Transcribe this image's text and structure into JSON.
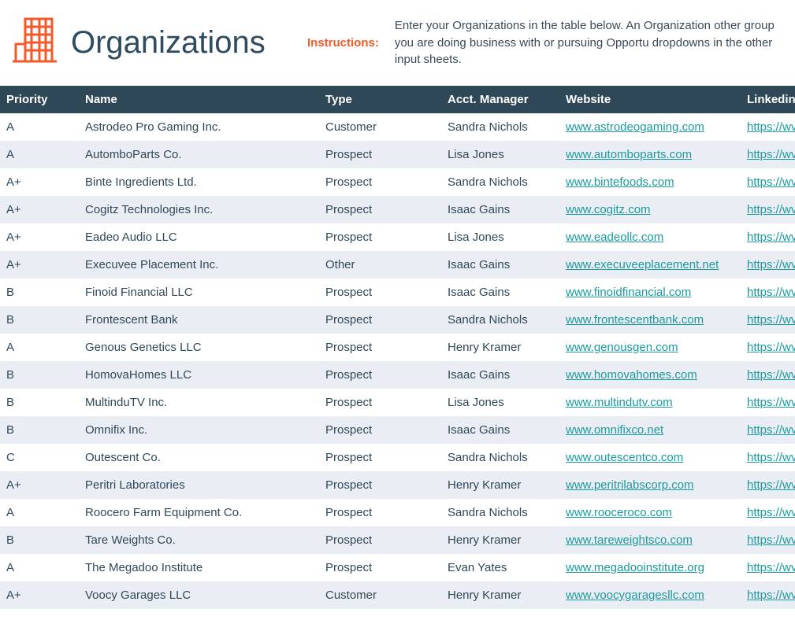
{
  "header": {
    "title": "Organizations",
    "instructions_label": "Instructions:",
    "instructions_text": "Enter your Organizations in the table below. An Organization other group you are doing business with or pursuing Opportu dropdowns in the other input sheets."
  },
  "columns": {
    "priority": "Priority",
    "name": "Name",
    "type": "Type",
    "manager": "Acct. Manager",
    "website": "Website",
    "linkedin": "Linkedin"
  },
  "rows": [
    {
      "priority": "A",
      "name": "Astrodeo Pro Gaming Inc.",
      "type": "Customer",
      "manager": "Sandra Nichols",
      "website": "www.astrodeogaming.com",
      "linkedin": "https://wv"
    },
    {
      "priority": "A",
      "name": "AutomboParts Co.",
      "type": "Prospect",
      "manager": "Lisa Jones",
      "website": "www.automboparts.com",
      "linkedin": "https://wv"
    },
    {
      "priority": "A+",
      "name": "Binte Ingredients Ltd.",
      "type": "Prospect",
      "manager": "Sandra Nichols",
      "website": "www.bintefoods.com",
      "linkedin": "https://wv"
    },
    {
      "priority": "A+",
      "name": "Cogitz Technologies Inc.",
      "type": "Prospect",
      "manager": "Isaac Gains",
      "website": "www.cogitz.com",
      "linkedin": "https://wv"
    },
    {
      "priority": "A+",
      "name": "Eadeo Audio LLC",
      "type": "Prospect",
      "manager": "Lisa Jones",
      "website": "www.eadeollc.com",
      "linkedin": "https://wv"
    },
    {
      "priority": "A+",
      "name": "Execuvee Placement Inc.",
      "type": "Other",
      "manager": "Isaac Gains",
      "website": "www.execuveeplacement.net",
      "linkedin": "https://wv"
    },
    {
      "priority": "B",
      "name": "Finoid Financial LLC",
      "type": "Prospect",
      "manager": "Isaac Gains",
      "website": "www.finoidfinancial.com",
      "linkedin": "https://wv"
    },
    {
      "priority": "B",
      "name": "Frontescent Bank",
      "type": "Prospect",
      "manager": "Sandra Nichols",
      "website": "www.frontescentbank.com",
      "linkedin": "https://wv"
    },
    {
      "priority": "A",
      "name": "Genous Genetics LLC",
      "type": "Prospect",
      "manager": "Henry Kramer",
      "website": "www.genousgen.com",
      "linkedin": "https://wv"
    },
    {
      "priority": "B",
      "name": "HomovaHomes LLC",
      "type": "Prospect",
      "manager": "Isaac Gains",
      "website": "www.homovahomes.com",
      "linkedin": "https://wv"
    },
    {
      "priority": "B",
      "name": "MultinduTV Inc.",
      "type": "Prospect",
      "manager": "Lisa Jones",
      "website": "www.multindutv.com",
      "linkedin": "https://wv"
    },
    {
      "priority": "B",
      "name": "Omnifix Inc.",
      "type": "Prospect",
      "manager": "Isaac Gains",
      "website": "www.omnifixco.net",
      "linkedin": "https://wv"
    },
    {
      "priority": "C",
      "name": "Outescent Co.",
      "type": "Prospect",
      "manager": "Sandra Nichols",
      "website": "www.outescentco.com",
      "linkedin": "https://wv"
    },
    {
      "priority": "A+",
      "name": "Peritri Laboratories",
      "type": "Prospect",
      "manager": "Henry Kramer",
      "website": "www.peritrilabscorp.com",
      "linkedin": "https://wv"
    },
    {
      "priority": "A",
      "name": "Roocero Farm Equipment Co.",
      "type": "Prospect",
      "manager": "Sandra Nichols",
      "website": "www.rooceroco.com",
      "linkedin": "https://wv"
    },
    {
      "priority": "B",
      "name": "Tare Weights Co.",
      "type": "Prospect",
      "manager": "Henry Kramer",
      "website": "www.tareweightsco.com",
      "linkedin": "https://wv"
    },
    {
      "priority": "A",
      "name": "The Megadoo Institute",
      "type": "Prospect",
      "manager": "Evan Yates",
      "website": "www.megadooinstitute.org",
      "linkedin": "https://wv"
    },
    {
      "priority": "A+",
      "name": "Voocy Garages LLC",
      "type": "Customer",
      "manager": "Henry Kramer",
      "website": "www.voocygaragesllc.com",
      "linkedin": "https://wv"
    }
  ]
}
